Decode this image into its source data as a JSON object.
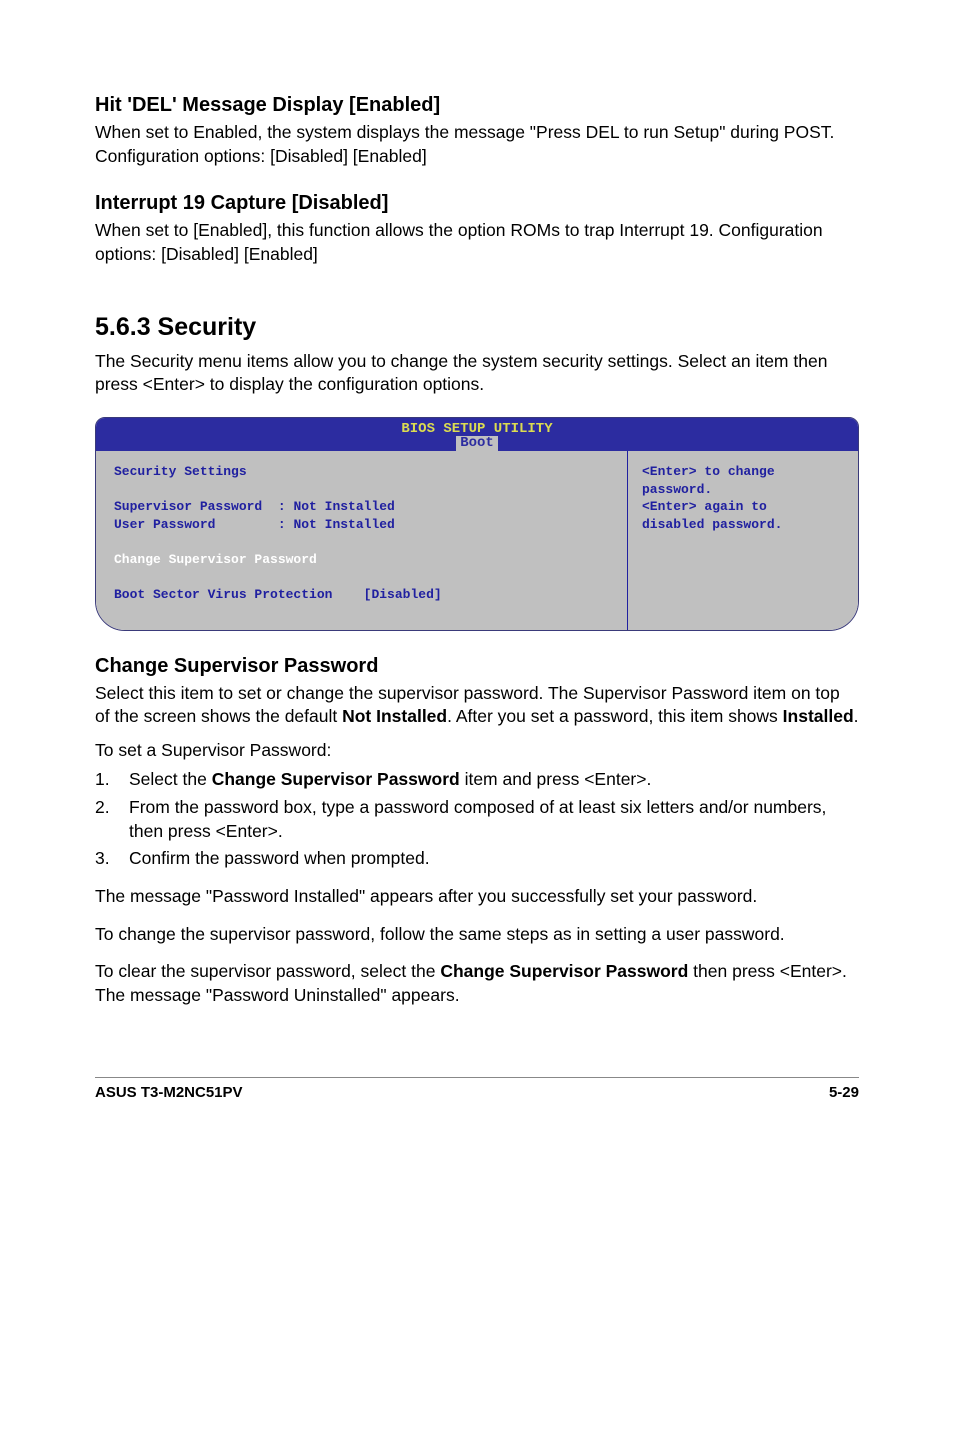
{
  "h1": "Hit 'DEL' Message Display [Enabled]",
  "p1": "When set to Enabled, the system displays the message \"Press DEL to run Setup\" during POST. Configuration options: [Disabled] [Enabled]",
  "h2": "Interrupt 19 Capture [Disabled]",
  "p2": "When set to [Enabled], this function allows the option ROMs to trap Interrupt 19. Configuration options: [Disabled] [Enabled]",
  "h3": "5.6.3   Security",
  "p3": "The Security menu items allow you to change the system security settings. Select an item then press <Enter> to display the configuration options.",
  "bios": {
    "title": "BIOS SETUP UTILITY",
    "tab": "Boot",
    "left": {
      "heading": "Security Settings",
      "row1_label": "Supervisor Password",
      "row1_value": ": Not Installed",
      "row2_label": "User Password",
      "row2_value": ": Not Installed",
      "row3": "Change Supervisor Password",
      "row4_label": "Boot Sector Virus Protection",
      "row4_value": "[Disabled]"
    },
    "right": {
      "l1": "<Enter> to change",
      "l2": "password.",
      "l3": "<Enter> again to",
      "l4": "disabled password."
    }
  },
  "h4": "Change Supervisor Password",
  "p4a": "Select this item to set or change the supervisor password. The Supervisor Password item on top of the screen shows the default ",
  "p4b": "Not Installed",
  "p4c": ". After you set a password, this item shows ",
  "p4d": "Installed",
  "p4e": ".",
  "p5": "To set a Supervisor Password:",
  "li1a": "Select the ",
  "li1b": "Change Supervisor Password",
  "li1c": " item and press <Enter>.",
  "li2": "From the password box, type a password composed of at least six letters and/or numbers, then press <Enter>.",
  "li3": "Confirm the password when prompted.",
  "p6": "The message \"Password Installed\" appears after you successfully set your password.",
  "p7": "To change the supervisor password, follow the same steps as in setting a user password.",
  "p8a": "To clear the supervisor password, select the ",
  "p8b": "Change Supervisor Password",
  "p8c": " then press <Enter>. The message \"Password Uninstalled\" appears.",
  "footer_left": "ASUS T3-M2NC51PV",
  "footer_right": "5-29"
}
